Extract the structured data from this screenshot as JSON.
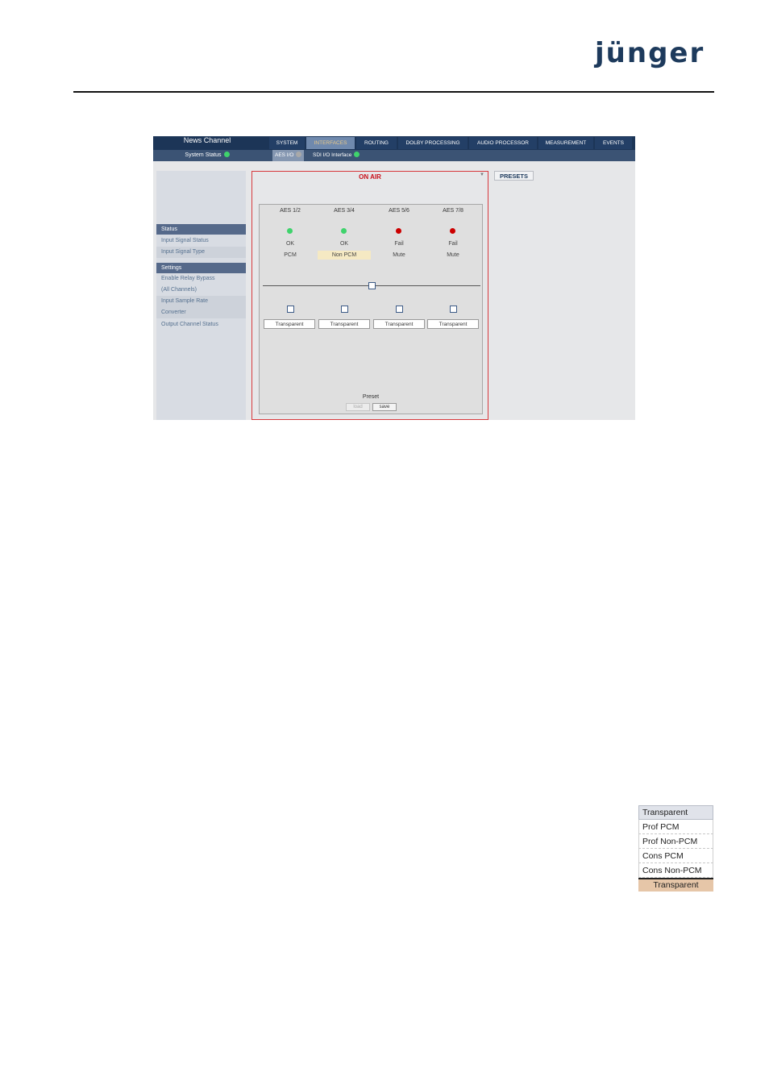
{
  "brand": {
    "logo_text": "jünger"
  },
  "app": {
    "title": "News Channel",
    "system_status_label": "System Status",
    "colors": {
      "header_bg": "#1c3557",
      "active_tab_text": "#e8c98a",
      "status_ok": "#3fd36c",
      "status_fail": "#cc0000",
      "status_neutral": "#a9a9a9",
      "on_air": "#c8101b"
    }
  },
  "tabs": [
    {
      "label": "SYSTEM",
      "active": false
    },
    {
      "label": "INTERFACES",
      "active": true
    },
    {
      "label": "ROUTING",
      "active": false
    },
    {
      "label": "DOLBY PROCESSING",
      "active": false
    },
    {
      "label": "AUDIO PROCESSOR",
      "active": false
    },
    {
      "label": "MEASUREMENT",
      "active": false
    },
    {
      "label": "EVENTS",
      "active": false
    }
  ],
  "subtabs": [
    {
      "label": "AES I/O",
      "active": true,
      "indicator": "neutral"
    },
    {
      "label": "SDI I/O Interface",
      "active": false,
      "indicator": "ok"
    }
  ],
  "sidebar": {
    "sections": [
      {
        "heading": "Status",
        "items": [
          "Input Signal Status",
          "Input Signal Type"
        ]
      },
      {
        "heading": "Settings",
        "items": [
          "Enable Relay Bypass",
          "(All Channels)",
          "Input Sample Rate",
          "Converter",
          "Output Channel Status"
        ]
      }
    ]
  },
  "main": {
    "on_air_label": "ON AIR",
    "collapse_icon": "triangle-down-icon",
    "channels": [
      {
        "label": "AES 1/2",
        "status": "OK",
        "led": "ok",
        "type": "PCM",
        "highlighted": false,
        "relay_bypass": false,
        "output_status": "Transparent"
      },
      {
        "label": "AES 3/4",
        "status": "OK",
        "led": "ok",
        "type": "Non PCM",
        "highlighted": true,
        "relay_bypass": false,
        "output_status": "Transparent"
      },
      {
        "label": "AES 5/6",
        "status": "Fail",
        "led": "fail",
        "type": "Mute",
        "highlighted": false,
        "relay_bypass": false,
        "output_status": "Transparent"
      },
      {
        "label": "AES 7/8",
        "status": "Fail",
        "led": "fail",
        "type": "Mute",
        "highlighted": false,
        "relay_bypass": false,
        "output_status": "Transparent"
      }
    ],
    "preset": {
      "label": "Preset",
      "load_label": "load",
      "save_label": "save"
    }
  },
  "presets_button": "PRESETS",
  "dropdown": {
    "header": "Transparent",
    "options": [
      "Prof PCM",
      "Prof Non-PCM",
      "Cons PCM",
      "Cons Non-PCM"
    ],
    "current": "Transparent"
  }
}
